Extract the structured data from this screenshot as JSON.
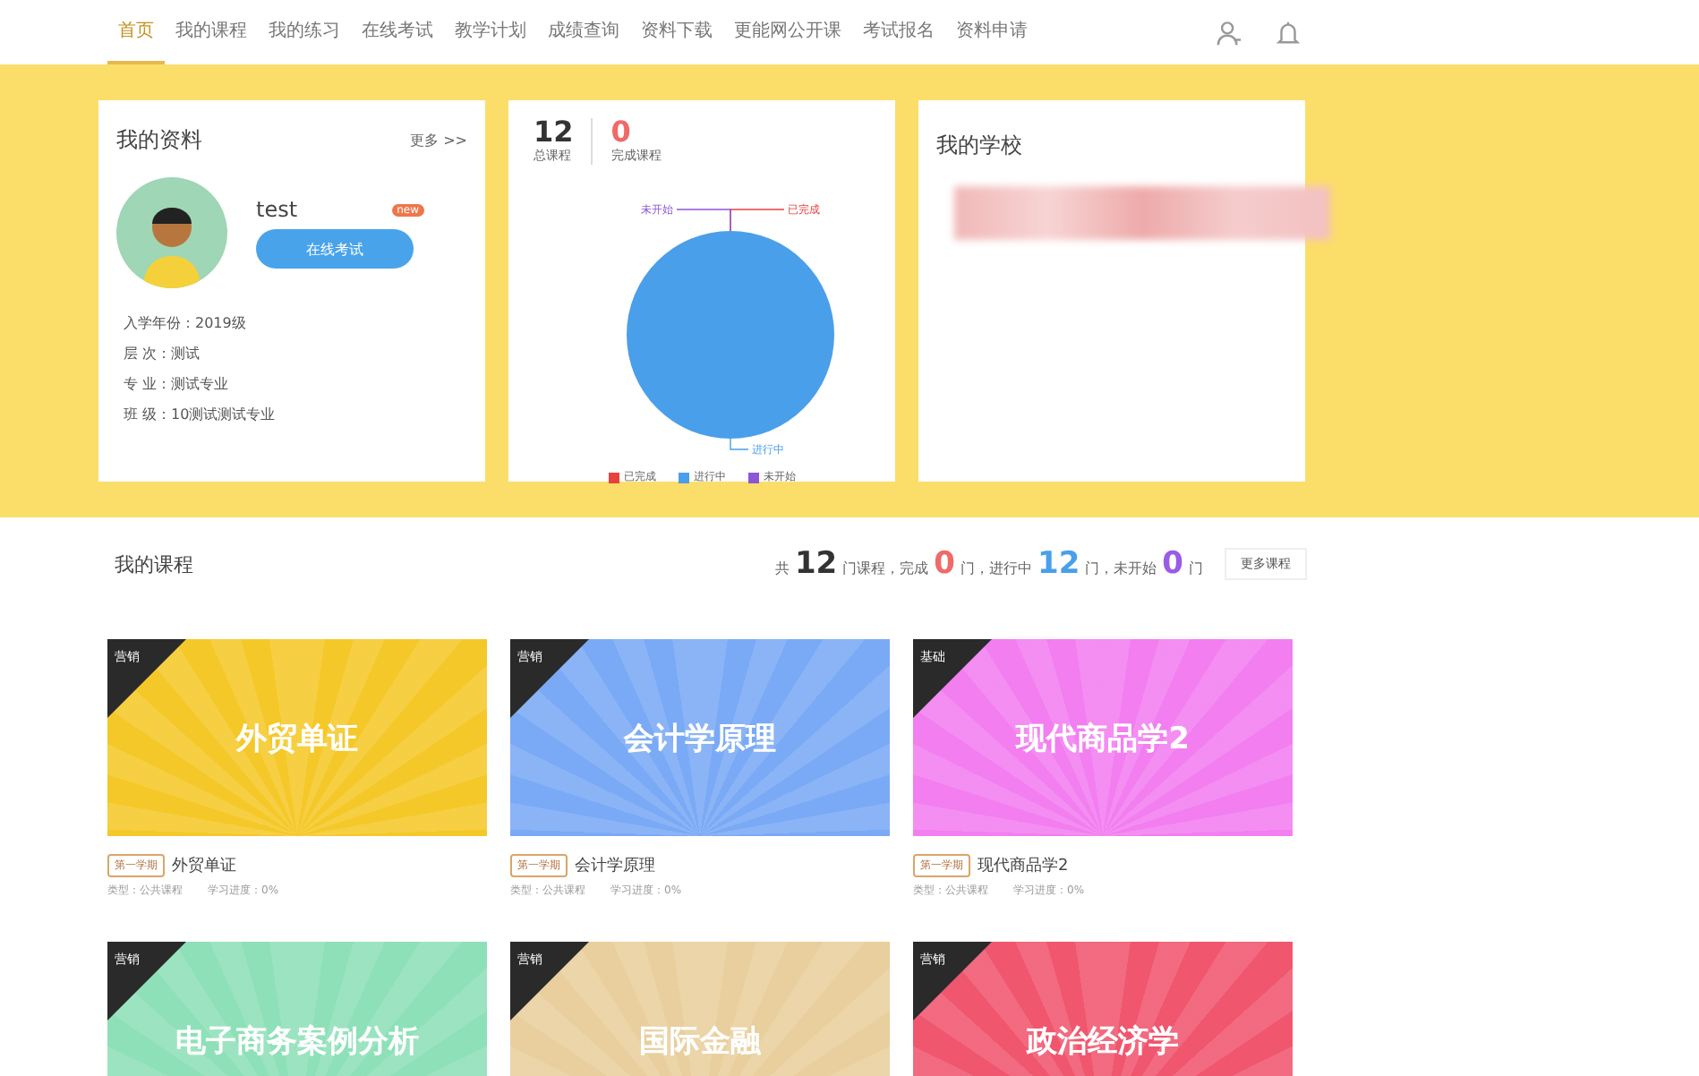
{
  "nav": {
    "items": [
      {
        "label": "首页",
        "selected": true
      },
      {
        "label": "我的课程",
        "selected": false
      },
      {
        "label": "我的练习",
        "selected": false
      },
      {
        "label": "在线考试",
        "selected": false
      },
      {
        "label": "教学计划",
        "selected": false
      },
      {
        "label": "成绩查询",
        "selected": false
      },
      {
        "label": "资料下载",
        "selected": false
      },
      {
        "label": "更能网公开课",
        "selected": false
      },
      {
        "label": "考试报名",
        "selected": false
      },
      {
        "label": "资料申请",
        "selected": false
      }
    ]
  },
  "profile": {
    "title": "我的资料",
    "more": "更多 >>",
    "name": "test",
    "button": "在线考试",
    "badge": "new",
    "fields": [
      "入学年份：2019级",
      "层 次：测试",
      "专 业：测试专业",
      "班 级：10测试测试专业"
    ]
  },
  "stats": {
    "total": "12",
    "total_label": "总课程",
    "done": "0",
    "done_label": "完成课程",
    "chart_data": {
      "type": "pie",
      "categories": [
        "已完成",
        "进行中",
        "未开始"
      ],
      "series": [
        {
          "values": [
            0,
            100,
            0
          ]
        }
      ],
      "colors": [
        "#e8413e",
        "#4a9fea",
        "#8e55d6"
      ]
    }
  },
  "school": {
    "title": "我的学校"
  },
  "courses_header": {
    "title": "我的课程",
    "summary": [
      {
        "text": "共"
      },
      {
        "number": "12",
        "color": "#333333"
      },
      {
        "text": "门课程，完成"
      },
      {
        "number": "0",
        "color": "#f06a6a"
      },
      {
        "text": "门，进行中"
      },
      {
        "number": "12",
        "color": "#4a9fea"
      },
      {
        "text": "门，未开始"
      },
      {
        "number": "0",
        "color": "#9a5ce6"
      },
      {
        "text": "门"
      }
    ],
    "more": "更多课程"
  },
  "courses": [
    {
      "corner": "营销",
      "title": "外贸单证",
      "color": "#f5c829",
      "term": "第一学期",
      "name": "外贸单证",
      "type": "类型：公共课程",
      "progress": "学习进度：0%"
    },
    {
      "corner": "营销",
      "title": "会计学原理",
      "color": "#7aaaf5",
      "term": "第一学期",
      "name": "会计学原理",
      "type": "类型：公共课程",
      "progress": "学习进度：0%"
    },
    {
      "corner": "基础",
      "title": "现代商品学2",
      "color": "#f27ef0",
      "term": "第一学期",
      "name": "现代商品学2",
      "type": "类型：公共课程",
      "progress": "学习进度：0%"
    },
    {
      "corner": "营销",
      "title": "电子商务案例分析",
      "color": "#8ee0b8"
    },
    {
      "corner": "营销",
      "title": "国际金融",
      "color": "#e8cf9d"
    },
    {
      "corner": "营销",
      "title": "政治经济学",
      "color": "#f0566e"
    }
  ]
}
